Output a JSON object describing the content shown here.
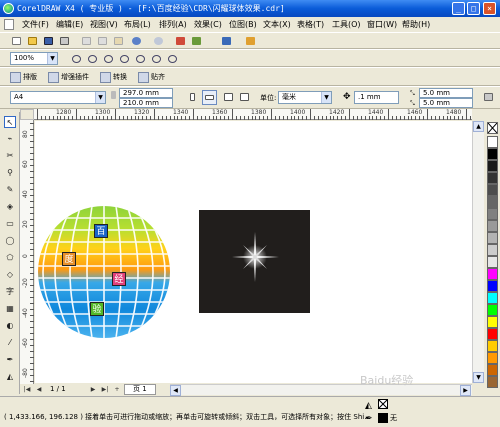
{
  "window": {
    "title": "CorelDRAW X4 ( 专业版 ) - [F:\\百度经验\\CDR\\闪耀球体效果.cdr]",
    "min": "_",
    "max": "□",
    "close": "×"
  },
  "menu": [
    "文件(F)",
    "编辑(E)",
    "视图(V)",
    "布局(L)",
    "排列(A)",
    "效果(C)",
    "位图(B)",
    "文本(X)",
    "表格(T)",
    "工具(O)",
    "窗口(W)",
    "帮助(H)"
  ],
  "toolbar": {
    "zoom": "100%",
    "plugin_buttons": [
      "排版",
      "增强插件",
      "转换",
      "贴齐"
    ]
  },
  "property_bar": {
    "page_size": "A4",
    "width": "297.0 mm",
    "height": "210.0 mm",
    "unit_label": "单位:",
    "unit": "毫米",
    "nudge": ".1 mm",
    "dup_x": "5.0 mm",
    "dup_y": "5.0 mm"
  },
  "ruler": {
    "h_labels": [
      "1280",
      "1300",
      "1320",
      "1340",
      "1360",
      "1380",
      "1400",
      "1420",
      "1440",
      "1460",
      "1480"
    ],
    "v_labels": [
      "80",
      "60",
      "40",
      "20",
      "0",
      "-20",
      "-40",
      "-60",
      "-80"
    ]
  },
  "page_nav": {
    "current": "1 / 1",
    "tab": "页 1"
  },
  "globe_chars": [
    "百",
    "度",
    "经",
    "验"
  ],
  "status": {
    "text": "( 1,433.166, 196.128 ) 接着单击可进行拖动或缩放；再单击可旋转或倾斜；双击工具，可选择所有对象；按住 Shi...",
    "fill_label": "无"
  },
  "palette_colors": [
    "#ffffff",
    "#000000",
    "#1a1a1a",
    "#333333",
    "#4d4d4d",
    "#666666",
    "#808080",
    "#999999",
    "#b3b3b3",
    "#cccccc",
    "#e6e6e6",
    "#ff00ff",
    "#0000ff",
    "#00ffff",
    "#00ff00",
    "#ffff00",
    "#ff0000",
    "#ffcc00",
    "#ff9900",
    "#cc6600",
    "#996633"
  ],
  "watermark": "Baidu经验"
}
